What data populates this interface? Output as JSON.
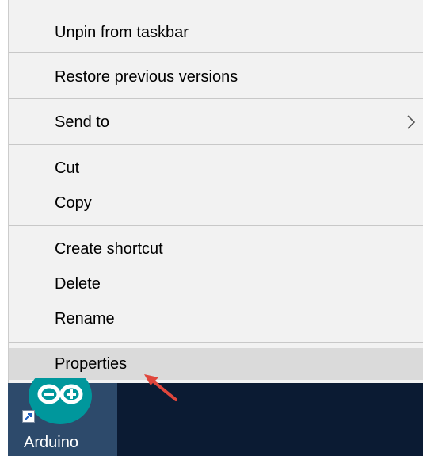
{
  "context_menu": {
    "items": [
      {
        "label": "Unpin from taskbar"
      },
      {
        "label": "Restore previous versions"
      },
      {
        "label": "Send to",
        "submenu": true
      },
      {
        "label": "Cut"
      },
      {
        "label": "Copy"
      },
      {
        "label": "Create shortcut"
      },
      {
        "label": "Delete"
      },
      {
        "label": "Rename"
      },
      {
        "label": "Properties",
        "hovered": true
      }
    ]
  },
  "taskbar": {
    "app_tile": {
      "label": "Arduino",
      "icon": "arduino-logo-icon"
    }
  },
  "colors": {
    "menu_bg": "#f2f2f2",
    "hover_bg": "#dadada",
    "taskbar_bg": "#0b1b33",
    "tile_bg": "#2d4a6b",
    "arduino_teal": "#00979c",
    "annotation_arrow": "#e0463c"
  }
}
